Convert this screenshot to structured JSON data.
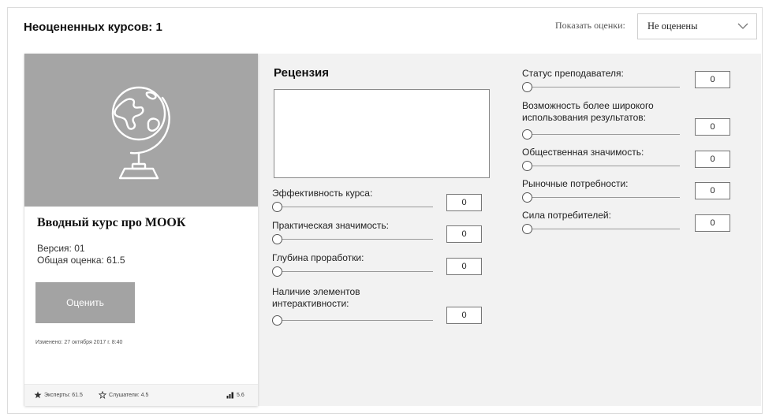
{
  "header": {
    "title": "Неоцененных курсов: 1",
    "filter_label": "Показать оценки:",
    "filter_value": "Не оценены"
  },
  "course": {
    "title": "Вводный курс про МООК",
    "version": "Версия: 01",
    "score": "Общая оценка: 61.5",
    "rate_button": "Оценить",
    "modified": "Изменено: 27 октября 2017 г. 8:40",
    "footer": {
      "experts": "Эксперты: 61.5",
      "listeners": "Слушатели: 4.5",
      "metric": "5.6"
    }
  },
  "review": {
    "title": "Рецензия",
    "text": ""
  },
  "criteria_left": [
    {
      "label": "Эффективность курса:",
      "value": "0"
    },
    {
      "label": "Практическая значимость:",
      "value": "0"
    },
    {
      "label": "Глубина проработки:",
      "value": "0"
    },
    {
      "label": "Наличие элементов интерактивности:",
      "value": "0"
    }
  ],
  "criteria_right": [
    {
      "label": "Статус преподавателя:",
      "value": "0"
    },
    {
      "label": "Возможность более широкого использования результатов:",
      "value": "0"
    },
    {
      "label": "Общественная значимость:",
      "value": "0"
    },
    {
      "label": "Рыночные потребности:",
      "value": "0"
    },
    {
      "label": "Сила потребителей:",
      "value": "0"
    }
  ],
  "slider_levels": {
    "left": [
      0,
      0,
      0,
      0
    ],
    "right": [
      0,
      0,
      0,
      0,
      0
    ]
  },
  "icons": {
    "card_image": "globe-icon",
    "filter": "chevron-down-icon",
    "experts": "star-filled-icon",
    "listeners": "star-outline-icon",
    "metric": "bar-chart-icon"
  }
}
